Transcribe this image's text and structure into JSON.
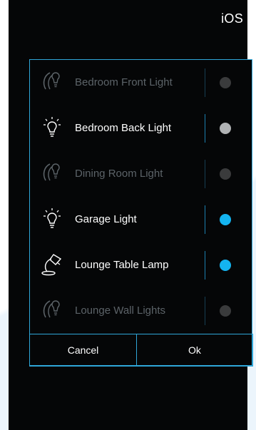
{
  "status": {
    "platform": "iOS"
  },
  "dialog": {
    "items": [
      {
        "label": "Bedroom Front Light",
        "icon": "dimmed-bulb-icon",
        "state": "off"
      },
      {
        "label": "Bedroom Back Light",
        "icon": "bulb-icon",
        "state": "partial"
      },
      {
        "label": "Dining Room Light",
        "icon": "dimmed-bulb-icon",
        "state": "off"
      },
      {
        "label": "Garage Light",
        "icon": "bulb-icon",
        "state": "on"
      },
      {
        "label": "Lounge Table Lamp",
        "icon": "table-lamp-icon",
        "state": "on"
      },
      {
        "label": "Lounge Wall Lights",
        "icon": "dimmed-bulb-icon",
        "state": "off"
      }
    ],
    "buttons": {
      "cancel": "Cancel",
      "ok": "Ok"
    }
  },
  "colors": {
    "accent": "#2fa6d8",
    "toggle_on": "#14b4f0",
    "toggle_partial": "#b0b2b4",
    "toggle_off": "#3a3b3c",
    "background": "#050607"
  }
}
